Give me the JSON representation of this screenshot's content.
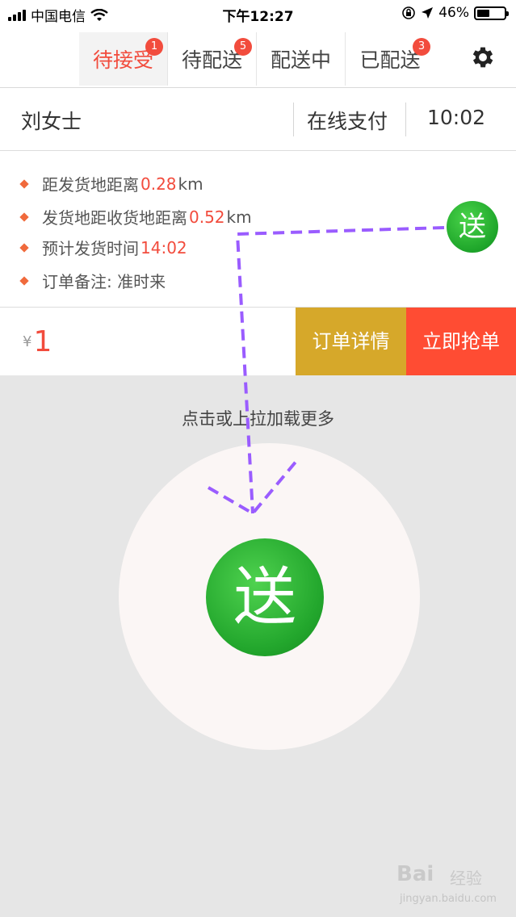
{
  "status_bar": {
    "carrier": "中国电信",
    "time": "下午12:27",
    "battery": "46%",
    "battery_level": 0.46
  },
  "tabs": [
    {
      "label": "待接受",
      "badge": "1",
      "active": true
    },
    {
      "label": "待配送",
      "badge": "5",
      "active": false
    },
    {
      "label": "配送中",
      "badge": "",
      "active": false
    },
    {
      "label": "已配送",
      "badge": "3",
      "active": false
    }
  ],
  "order": {
    "customer": "刘女士",
    "payment": "在线支付",
    "time": "10:02",
    "details": [
      {
        "label": "距发货地距离",
        "value": "0.28",
        "unit": "km"
      },
      {
        "label": "发货地距收货地距离",
        "value": "0.52",
        "unit": "km"
      },
      {
        "label": "预计发货时间",
        "value": "14:02",
        "unit": ""
      },
      {
        "label": "订单备注: 准时来",
        "value": "",
        "unit": ""
      }
    ],
    "send_label": "送",
    "currency": "¥",
    "price": "1",
    "detail_button": "订单详情",
    "grab_button": "立即抢单"
  },
  "load_more": "点击或上拉加载更多",
  "zoom": {
    "send_label": "送"
  },
  "watermark": {
    "main": "Bai",
    "sub": "经验",
    "url": "jingyan.baidu.com"
  },
  "colors": {
    "accent_red": "#f24c3d",
    "detail_button": "#d6a82a",
    "grab_button": "#ff4c33",
    "send_green": "#23a72d",
    "annotation": "#9a5cff"
  }
}
